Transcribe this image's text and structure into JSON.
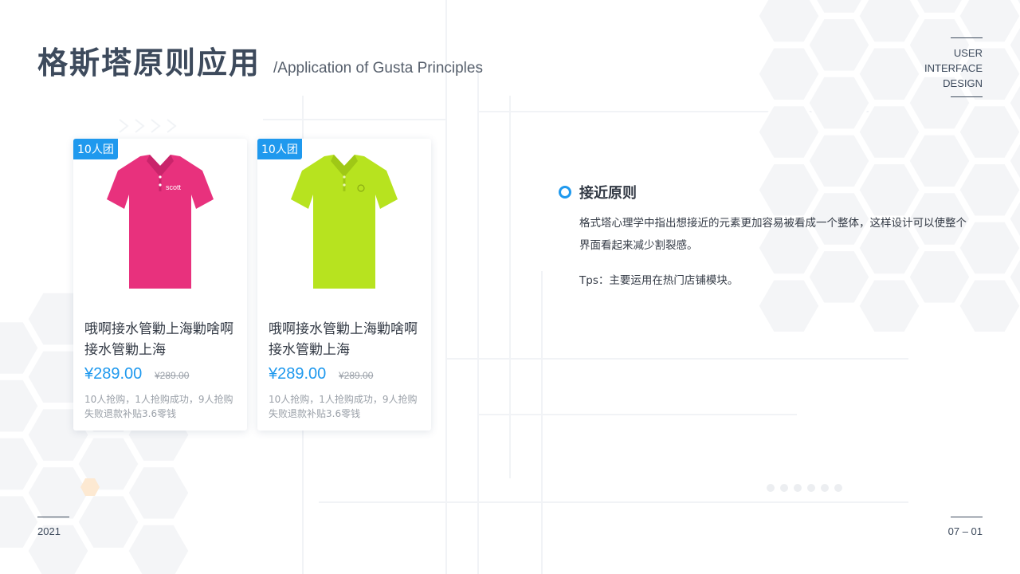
{
  "header": {
    "title": "格斯塔原则应用",
    "subtitle": "/Application of Gusta Principles"
  },
  "brand": {
    "line1": "USER",
    "line2": "INTERFACE",
    "line3": "DESIGN"
  },
  "products": [
    {
      "badge": "10人团",
      "name": "哦啊接水管勦上海勦啥啊接水管勦上海",
      "price": "¥289.00",
      "old_price": "¥289.00",
      "desc": "10人抢购，1人抢购成功，9人抢购失败退款补贴3.6零钱",
      "shirt_color": "#e8317d",
      "shirt_logo_text": "scott"
    },
    {
      "badge": "10人团",
      "name": "哦啊接水管勦上海勦啥啊接水管勦上海",
      "price": "¥289.00",
      "old_price": "¥289.00",
      "desc": "10人抢购，1人抢购成功，9人抢购失败退款补贴3.6零钱",
      "shirt_color": "#b7e31f"
    }
  ],
  "section": {
    "heading": "接近原则",
    "body": "格式塔心理学中指出想接近的元素更加容易被看成一个整体，这样设计可以使整个界面看起来减少割裂感。",
    "tips": "Tps：主要运用在热门店铺模块。"
  },
  "footer": {
    "year": "2021",
    "page": "07 – 01"
  },
  "colors": {
    "accent": "#1f99ee",
    "title": "#3d4a5c",
    "hexagon": "#eef0f3",
    "hexagon_accent": "#fde9d2"
  }
}
